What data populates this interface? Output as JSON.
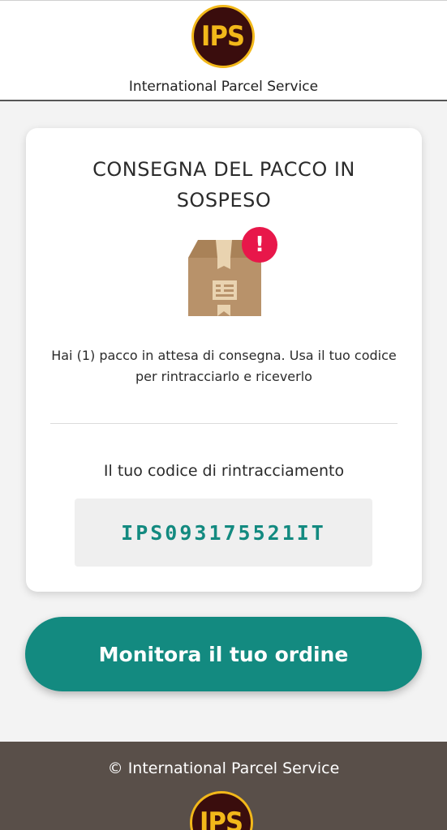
{
  "header": {
    "logo_text": "IPS",
    "subtitle": "International Parcel Service"
  },
  "card": {
    "title": "CONSEGNA DEL PACCO IN SOSPESO",
    "alert_symbol": "!",
    "message": "Hai (1) pacco in attesa di consegna. Usa il tuo codice per rintracciarlo e riceverlo",
    "tracking_label": "Il tuo codice di rintracciamento",
    "tracking_code": "IPS093175521IT"
  },
  "cta": {
    "label": "Monitora il tuo ordine"
  },
  "footer": {
    "copyright": "© International Parcel Service",
    "logo_text": "IPS"
  },
  "colors": {
    "brand_brown": "#3a0d0d",
    "brand_gold": "#f2b81a",
    "accent_teal": "#138a80",
    "footer_bg": "#594f49",
    "alert_red": "#e8174a"
  },
  "icons": {
    "package": "package-icon",
    "alert": "alert-badge-icon"
  }
}
